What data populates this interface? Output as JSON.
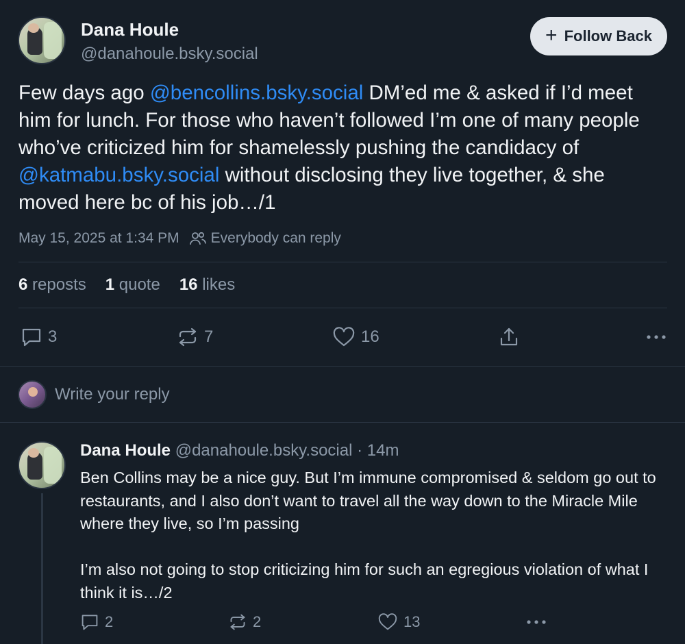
{
  "post": {
    "author": {
      "display_name": "Dana Houle",
      "handle": "@danahoule.bsky.social"
    },
    "follow_button": {
      "label": "Follow Back"
    },
    "text_parts": {
      "p1": "Few days ago ",
      "m1": "@bencollins.bsky.social",
      "p2": " DM’ed me & asked if I’d meet him for lunch. For those who haven’t followed I’m one of many people who’ve criticized him for shamelessly pushing the candidacy of ",
      "m2": "@katmabu.bsky.social",
      "p3": " without disclosing they live together, & she moved here bc of his job…/1"
    },
    "timestamp": "May 15, 2025 at 1:34 PM",
    "reply_setting": "Everybody can reply",
    "stats": {
      "reposts_count": "6",
      "reposts_label": "reposts",
      "quotes_count": "1",
      "quotes_label": "quote",
      "likes_count": "16",
      "likes_label": "likes"
    },
    "actions": {
      "replies": "3",
      "reposts": "7",
      "likes": "16"
    }
  },
  "reply_box": {
    "placeholder": "Write your reply"
  },
  "reply": {
    "display_name": "Dana Houle",
    "handle": "@danahoule.bsky.social",
    "time": "· 14m",
    "text": "Ben Collins may be a nice guy. But I’m immune compromised & seldom go out to restaurants, and I also don’t want to travel all the way down to the Miracle Mile where they live, so I’m passing\n\nI’m also not going to stop criticizing him for such an egregious violation of what I think it is…/2",
    "actions": {
      "replies": "2",
      "reposts": "2",
      "likes": "13"
    }
  },
  "icons": {
    "reply": "comment-icon",
    "repost": "repost-icon",
    "like": "heart-icon",
    "share": "share-icon",
    "more": "more-icon",
    "people": "people-icon"
  },
  "colors": {
    "background": "#161e27",
    "mention": "#2f8cf6",
    "muted": "#8c99a8",
    "button_bg": "#e3e7ec"
  }
}
